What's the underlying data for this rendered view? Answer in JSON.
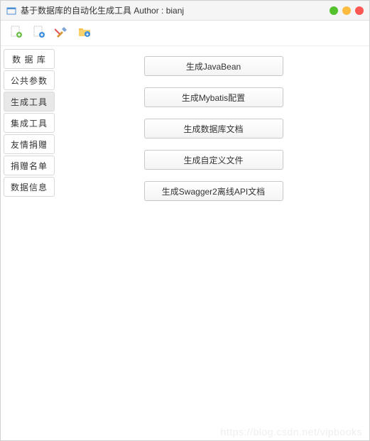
{
  "window": {
    "title": "基于数据库的自动化生成工具  Author : bianj"
  },
  "toolbar": {
    "icons": [
      "new",
      "add",
      "tools",
      "folder-download"
    ]
  },
  "sidebar": {
    "tabs": [
      {
        "label": "数 据 库",
        "active": false
      },
      {
        "label": "公共参数",
        "active": false
      },
      {
        "label": "生成工具",
        "active": true
      },
      {
        "label": "集成工具",
        "active": false
      },
      {
        "label": "友情捐赠",
        "active": false
      },
      {
        "label": "捐赠名单",
        "active": false
      },
      {
        "label": "数据信息",
        "active": false
      }
    ]
  },
  "content": {
    "buttons": [
      "生成JavaBean",
      "生成Mybatis配置",
      "生成数据库文档",
      "生成自定义文件",
      "生成Swagger2离线API文档"
    ]
  },
  "watermark": "https://blog.csdn.net/vipbooks"
}
